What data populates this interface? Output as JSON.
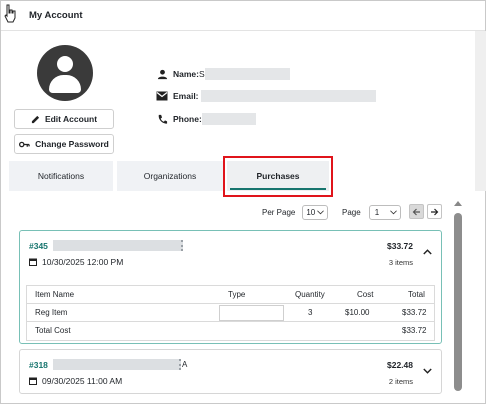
{
  "header": {
    "title": "My Account"
  },
  "profile": {
    "name_label": "Name:",
    "name_value": "S",
    "email_label": "Email:",
    "phone_label": "Phone:",
    "edit_label": "Edit Account",
    "change_password_label": "Change Password"
  },
  "tabs": [
    {
      "label": "Notifications"
    },
    {
      "label": "Organizations"
    },
    {
      "label": "Purchases"
    }
  ],
  "pagination": {
    "per_page_label": "Per Page",
    "per_page_value": "10",
    "page_label": "Page",
    "page_value": "1"
  },
  "orders": [
    {
      "number": "#345",
      "date": "10/30/2025 12:00 PM",
      "total": "$33.72",
      "items": "3 items",
      "table": {
        "headers": [
          "Item Name",
          "Type",
          "Quantity",
          "Cost",
          "Total"
        ],
        "rows": [
          {
            "name": "Reg Item",
            "type": "",
            "quantity": "3",
            "cost": "$10.00",
            "total": "$33.72"
          }
        ],
        "footer_label": "Total Cost",
        "footer_value": "$33.72"
      }
    },
    {
      "number": "#318",
      "date": "09/30/2025 11:00 AM",
      "total": "$22.48",
      "items": "2 items",
      "name_tail": "A"
    }
  ],
  "colors": {
    "accent": "#17756e",
    "highlight": "#e0141b",
    "avatar": "#3a3a3a"
  },
  "icons": [
    "cursor-hand-icon",
    "person-icon",
    "mail-icon",
    "phone-icon",
    "pencil-icon",
    "key-icon",
    "calendar-icon",
    "chevron-up-icon",
    "chevron-down-icon",
    "arrow-left-icon",
    "arrow-right-icon"
  ]
}
